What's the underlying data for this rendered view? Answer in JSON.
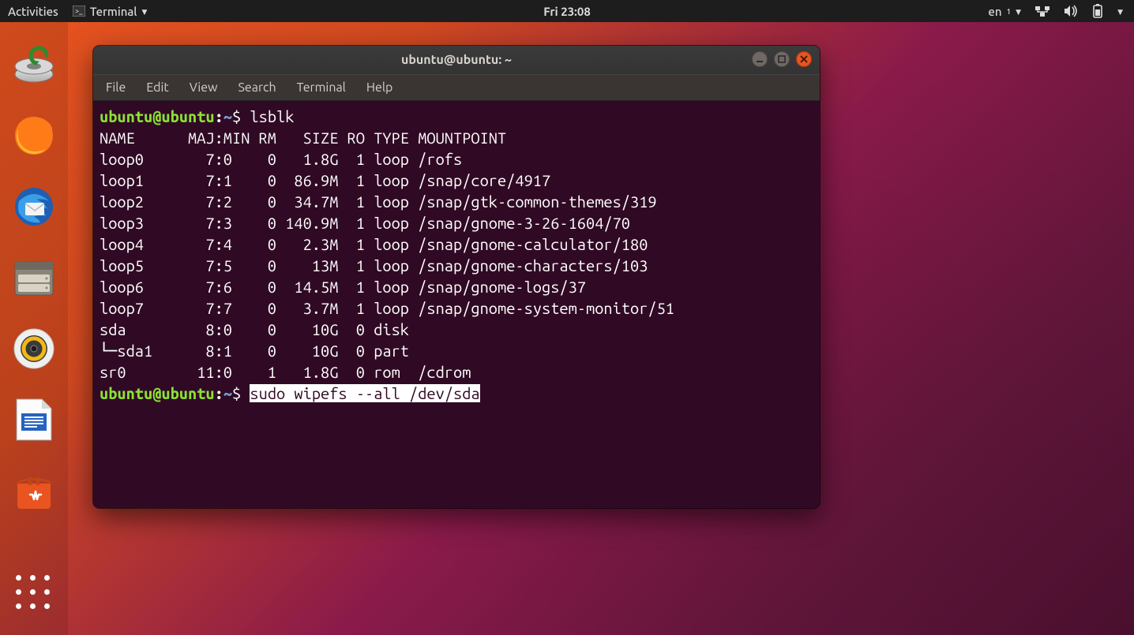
{
  "topbar": {
    "activities": "Activities",
    "appmenu": "Terminal",
    "clock": "Fri 23:08",
    "lang": "en",
    "lang_sub": "1"
  },
  "dock": {
    "items": [
      "install-ubuntu-icon",
      "firefox-icon",
      "thunderbird-icon",
      "files-icon",
      "rhythmbox-icon",
      "libreoffice-writer-icon",
      "ubuntu-software-icon"
    ]
  },
  "terminal": {
    "title": "ubuntu@ubuntu: ~",
    "menu": [
      "File",
      "Edit",
      "View",
      "Search",
      "Terminal",
      "Help"
    ],
    "prompt": {
      "user": "ubuntu@ubuntu",
      "path": "~"
    },
    "cmd1": "lsblk",
    "header": "NAME      MAJ:MIN RM   SIZE RO TYPE MOUNTPOINT",
    "rows": [
      "loop0       7:0    0   1.8G  1 loop /rofs",
      "loop1       7:1    0  86.9M  1 loop /snap/core/4917",
      "loop2       7:2    0  34.7M  1 loop /snap/gtk-common-themes/319",
      "loop3       7:3    0 140.9M  1 loop /snap/gnome-3-26-1604/70",
      "loop4       7:4    0   2.3M  1 loop /snap/gnome-calculator/180",
      "loop5       7:5    0    13M  1 loop /snap/gnome-characters/103",
      "loop6       7:6    0  14.5M  1 loop /snap/gnome-logs/37",
      "loop7       7:7    0   3.7M  1 loop /snap/gnome-system-monitor/51",
      "sda         8:0    0    10G  0 disk ",
      "└─sda1      8:1    0    10G  0 part ",
      "sr0        11:0    1   1.8G  0 rom  /cdrom"
    ],
    "cmd2": "sudo wipefs --all /dev/sda"
  }
}
